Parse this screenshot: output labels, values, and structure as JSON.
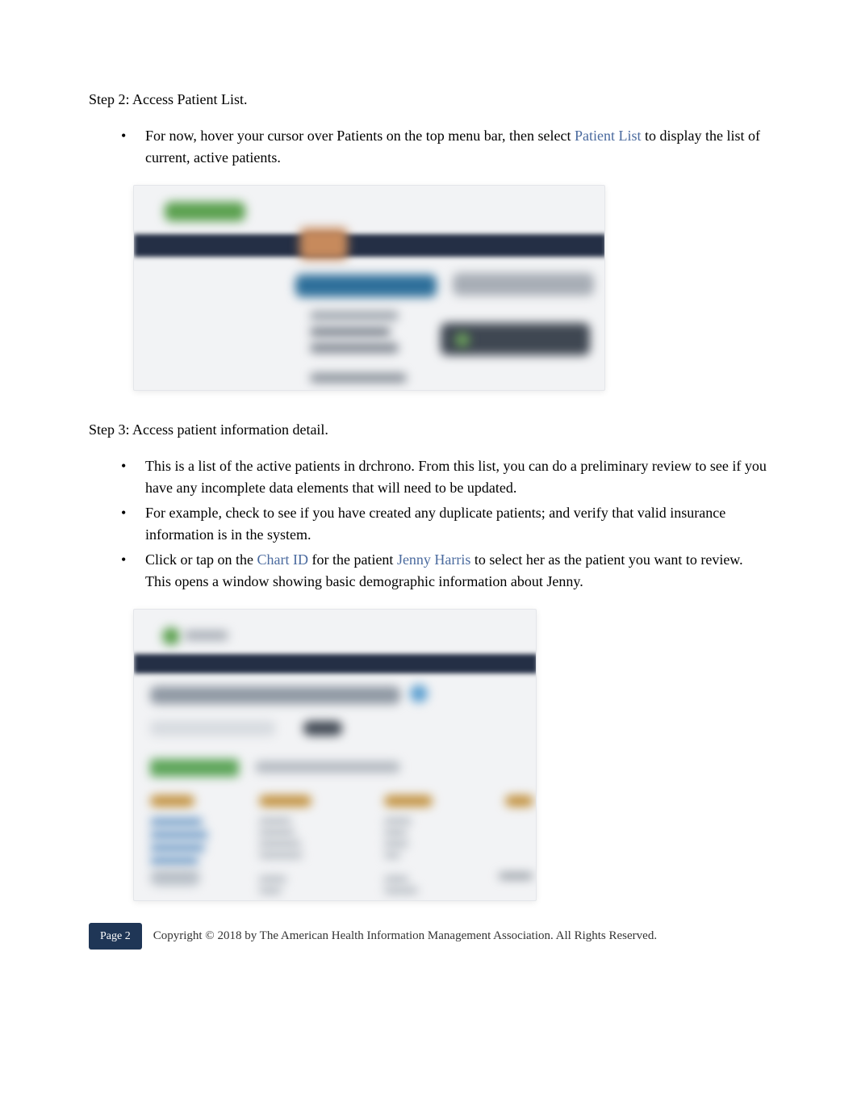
{
  "step2": {
    "heading": "Step 2: Access Patient List.",
    "bullet1_pre": "For now, hover your cursor over Patients on the top menu bar, then select ",
    "bullet1_link": "Patient List",
    "bullet1_post": " to display the list of current, active patients."
  },
  "step3": {
    "heading": "Step 3: Access patient information detail.",
    "bullet1": "This is a list of the active patients in drchrono. From this list, you can do a preliminary review to see if you have any incomplete data elements that will need to be updated.",
    "bullet2": "For example, check to see if you have created any duplicate patients; and verify that valid insurance information is in the system.",
    "bullet3_pre": "Click or tap on the ",
    "bullet3_link1": "Chart ID",
    "bullet3_mid": " for the patient ",
    "bullet3_link2": "Jenny Harris",
    "bullet3_post": " to select her as the patient you want to review. This opens a window showing basic demographic information about Jenny."
  },
  "footer": {
    "page_label": "Page 2",
    "copyright": "Copyright © 2018 by The American Health Information Management Association. All Rights Reserved."
  }
}
